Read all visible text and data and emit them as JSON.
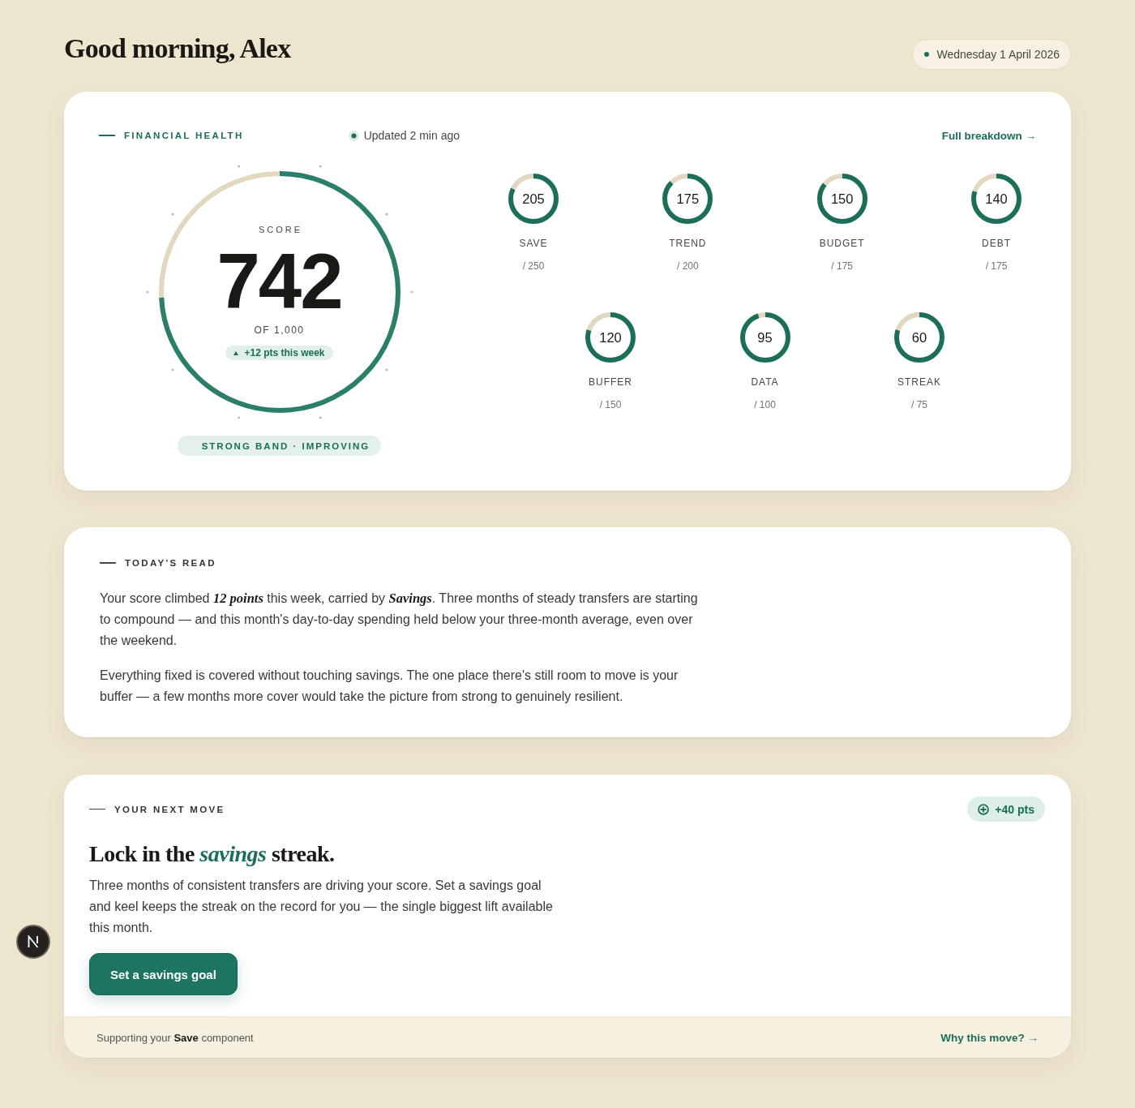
{
  "greeting": "Good morning, Alex",
  "date": "Wednesday 1 April 2026",
  "financial_health": {
    "label": "FINANCIAL HEALTH",
    "updated": "Updated 2 min ago",
    "link": "Full breakdown →",
    "score": {
      "label": "SCORE",
      "value": "742",
      "out_of": "OF 1,000",
      "level": 0.742,
      "change": "+12 pts this week"
    },
    "band": "STRONG BAND · IMPROVING",
    "components": [
      {
        "name": "SAVE",
        "value": "205",
        "max": "/ 250",
        "level": 0.82
      },
      {
        "name": "TREND",
        "value": "175",
        "max": "/ 200",
        "level": 0.875
      },
      {
        "name": "BUDGET",
        "value": "150",
        "max": "/ 175",
        "level": 0.857
      },
      {
        "name": "DEBT",
        "value": "140",
        "max": "/ 175",
        "level": 0.8
      },
      {
        "name": "BUFFER",
        "value": "120",
        "max": "/ 150",
        "level": 0.8
      },
      {
        "name": "DATA",
        "value": "95",
        "max": "/ 100",
        "level": 0.95
      },
      {
        "name": "STREAK",
        "value": "60",
        "max": "/ 75",
        "level": 0.8
      }
    ]
  },
  "todays_read": {
    "label": "TODAY'S READ",
    "paragraphs": [
      "Your score climbed *12 points* this week, carried by *Savings*. Three months of steady transfers are starting to compound — and this month's day-to-day spending held below your three-month average, even over the weekend.",
      "Everything fixed is covered without touching savings. The one place there's still room to move is your buffer — a few months more cover would take the picture from strong to genuinely resilient."
    ]
  },
  "next_move": {
    "label": "YOUR NEXT MOVE",
    "points": "+40 pts",
    "title": "Lock in the *savings* streak.",
    "body": "Three months of consistent transfers are driving your score. Set a savings goal and keel keeps the streak on the record for you — the single biggest lift available this month.",
    "button": "Set a savings goal",
    "footer_note": "Supporting your **Save** component",
    "footer_link": "Why this move? →"
  }
}
